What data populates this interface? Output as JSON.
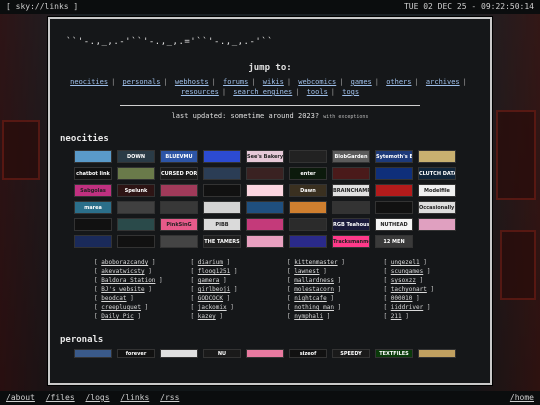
{
  "topbar": {
    "left": "[ sky://links ]",
    "right": "TUE 02 DEC 25 - 09:22:50:14"
  },
  "bottombar": {
    "links": [
      "/about",
      "/files",
      "/logs",
      "/links",
      "/rss"
    ],
    "right": "/home"
  },
  "ascii_header": "``'-.,_,.-'``'-.,_,.='``'-.,_,.-'``",
  "jump": {
    "title": "jump to:",
    "links": [
      "neocities",
      "personals",
      "webhosts",
      "forums",
      "wikis",
      "webcomics",
      "games",
      "others",
      "archives",
      "resources",
      "search engines",
      "tools",
      "togs"
    ]
  },
  "updated": {
    "text": "last updated: sometime around 2023?",
    "note": "with exceptions"
  },
  "sections": {
    "neocities": "neocities",
    "personals": "peronals"
  },
  "buttons": [
    {
      "label": "",
      "bg": "#5a9ac9"
    },
    {
      "label": "DOWN",
      "bg": "#2a3b46"
    },
    {
      "label": "BLUEVMU",
      "bg": "#2d55a6"
    },
    {
      "label": "",
      "bg": "#2c4bd1"
    },
    {
      "label": "See's Bakery",
      "bg": "#e6c9d8"
    },
    {
      "label": "",
      "bg": "#222"
    },
    {
      "label": "BlobGarden",
      "bg": "#5c5c5c"
    },
    {
      "label": "Sytemoth's Brook",
      "bg": "#1d3a7a"
    },
    {
      "label": "",
      "bg": "#c8b070"
    },
    {
      "label": "chatbot link",
      "bg": "#101010"
    },
    {
      "label": "",
      "bg": "#6a7a4a"
    },
    {
      "label": "CURSED PORTAL",
      "bg": "#1a1a1a"
    },
    {
      "label": "",
      "bg": "#2b3d55"
    },
    {
      "label": "",
      "bg": "#3a2222"
    },
    {
      "label": "enter",
      "bg": "#0c1a0c"
    },
    {
      "label": "",
      "bg": "#4a1a1a"
    },
    {
      "label": "",
      "bg": "#0f2f7a"
    },
    {
      "label": "CLUTCH DATA",
      "bg": "#10253a"
    },
    {
      "label": "Sabgolas",
      "bg": "#c03080"
    },
    {
      "label": "Spelunk",
      "bg": "#2d1414"
    },
    {
      "label": "",
      "bg": "#a03a5a"
    },
    {
      "label": "",
      "bg": "#111"
    },
    {
      "label": "",
      "bg": "#fbd5e0"
    },
    {
      "label": "Dawn",
      "bg": "#3a3020"
    },
    {
      "label": "BRAINCHAMP",
      "bg": "#e0e0e0"
    },
    {
      "label": "",
      "bg": "#b31b1b"
    },
    {
      "label": "Modelfile",
      "bg": "#f0f0f0"
    },
    {
      "label": "marea",
      "bg": "#2b6f8a"
    },
    {
      "label": "",
      "bg": "#404040"
    },
    {
      "label": "",
      "bg": "#383838"
    },
    {
      "label": "",
      "bg": "#d4d4d4"
    },
    {
      "label": "",
      "bg": "#1f4f7f"
    },
    {
      "label": "",
      "bg": "#cf7f2f"
    },
    {
      "label": "",
      "bg": "#333"
    },
    {
      "label": "",
      "bg": "#111"
    },
    {
      "label": "Occasionally Correct",
      "bg": "#ddd"
    },
    {
      "label": "",
      "bg": "#111"
    },
    {
      "label": "",
      "bg": "#2a4a4a"
    },
    {
      "label": "PinkSinG",
      "bg": "#e65a8a"
    },
    {
      "label": "PIBB",
      "bg": "#dadada"
    },
    {
      "label": "",
      "bg": "#c43a7a"
    },
    {
      "label": "",
      "bg": "#2b2b2b"
    },
    {
      "label": "RGB Teahouse",
      "bg": "#1a1a3a"
    },
    {
      "label": "NUTHEAD",
      "bg": "#f5f5f5"
    },
    {
      "label": "",
      "bg": "#e0a0c0"
    },
    {
      "label": "",
      "bg": "#1a2a5a"
    },
    {
      "label": "",
      "bg": "#111"
    },
    {
      "label": "",
      "bg": "#444"
    },
    {
      "label": "THE TAMERS",
      "bg": "#202020"
    },
    {
      "label": "",
      "bg": "#e8a0c0"
    },
    {
      "label": "",
      "bg": "#2a2a8a"
    },
    {
      "label": "Tracksmanmer",
      "bg": "#ff3a8a"
    },
    {
      "label": "12 MEN",
      "bg": "#3a3a3a"
    },
    {
      "label": ""
    }
  ],
  "link_columns": [
    [
      "aboborazcandy",
      "akevatwicsty",
      "Baldora Station",
      "BJ's website",
      "beodcat",
      "creepluquet",
      "Daily Pic"
    ],
    [
      "diarium",
      "floog1251",
      "gamera",
      "girlbeoji",
      "GODCOCK",
      "jackomix",
      "kazey"
    ],
    [
      "kittenmaster",
      "lawnest",
      "mallardness",
      "molestacorn",
      "nightcafe",
      "nothing man",
      "nymphali"
    ],
    [
      "ungezel1",
      "scungames",
      "sysoxzz",
      "tachyonart",
      "000010",
      "iiddriver",
      "211"
    ]
  ],
  "bottom_strip": [
    {
      "label": "",
      "bg": "#3a5a8a"
    },
    {
      "label": "forever",
      "bg": "#111"
    },
    {
      "label": "",
      "bg": "#e0e0e0"
    },
    {
      "label": "NU",
      "bg": "#1a1a1a"
    },
    {
      "label": "",
      "bg": "#e87aa0"
    },
    {
      "label": "sizeof",
      "bg": "#111"
    },
    {
      "label": "SPEEDY",
      "bg": "#1a1a1a"
    },
    {
      "label": "TEXTFILES",
      "bg": "#0a3a0a"
    },
    {
      "label": "",
      "bg": "#c0a060"
    }
  ]
}
